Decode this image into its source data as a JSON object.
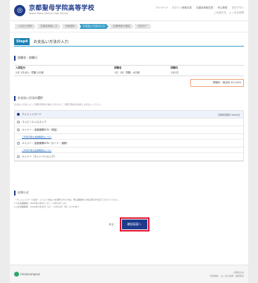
{
  "header": {
    "logo_glyph": "◎",
    "school_name": "京都聖母学院高等学校",
    "school_name_en": "Kyoto Seibo Gakuin High School",
    "nav": [
      "マイページ",
      "ログイン情報変更",
      "志願者情報変更",
      "申込履歴",
      "ログアウト"
    ],
    "sub_nav": [
      "ご利用方法",
      "よくある質問"
    ]
  },
  "steps": [
    "入試区分選択",
    "志願者情報入力",
    "試験選択",
    "お支払い方法の入力",
    "出願情報の確認",
    "送信完了"
  ],
  "step_section": {
    "badge": "Step4",
    "title": "お支払い方法の入力"
  },
  "exam_block": {
    "title": "試験名・試験日",
    "headers": [
      "入試区分",
      "試験名",
      "試験日"
    ],
    "row": [
      "2月 1日(月)・専願 A日程",
      "1日（月）専願・A日程",
      "2月1日"
    ]
  },
  "total": {
    "label": "受験料・検定料",
    "value": "¥21,600"
  },
  "payment_block": {
    "title": "お支払い方法の選択",
    "note": "お支払い方法によって事務手数料が異なりますので、事務手数料を確認しお支払いください。",
    "options": [
      {
        "label": "クレジットカード",
        "right": "【事務手数料 ¥###】"
      },
      {
        "label": "コンビニエンスストア",
        "right": ""
      },
      {
        "label": "ペイジー・金融機関ATM（現金）",
        "right": "",
        "link": "ご利用可能な金融機関はこちら"
      },
      {
        "label": "ペイジー・金融機関ATM（カード・通帳）",
        "right": "",
        "link": "ご利用可能な金融機関はこちら"
      },
      {
        "label": "ペイジー（ネットバンキング）",
        "right": ""
      }
    ]
  },
  "notice_block": {
    "title": "お知らせ",
    "lines": [
      "・クレジットカード決済・コンビニ支払いを選択された方は、申込期間中に支払手続きを完了させてください。",
      "1.1次出願期間：2024年1月9日（火）～1月23日（火）",
      "2.2次出願期間：2024年1月30日（火）～2月12日（月）12:00まで"
    ]
  },
  "buttons": {
    "back": "戻る",
    "confirm": "確認画面へ"
  },
  "footer": {
    "brand": "miraicompass",
    "links": [
      "お問合せ先",
      "利用規約　よくある質問　推奨環境"
    ]
  }
}
